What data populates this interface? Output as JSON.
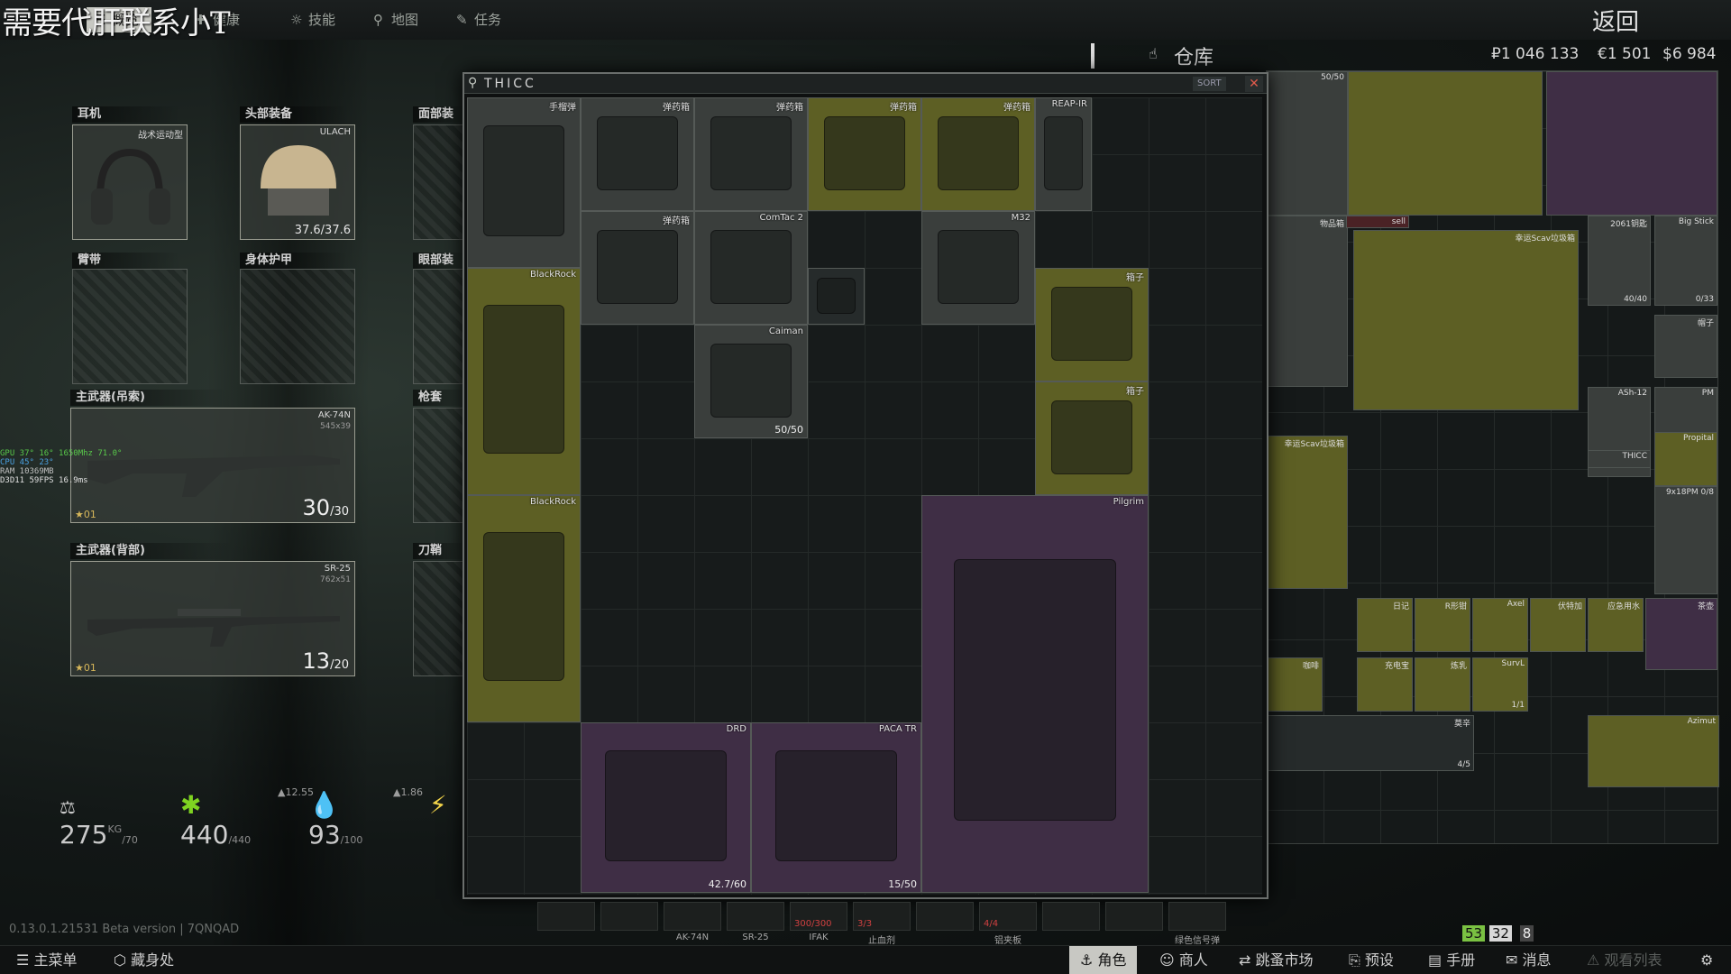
{
  "overlay": {
    "watermark": "需要代肝联系小T"
  },
  "nav": {
    "tabs": [
      {
        "label": "概览",
        "icon": "overview-icon"
      },
      {
        "label": "健康",
        "icon": "health-icon"
      },
      {
        "label": "技能",
        "icon": "skills-icon"
      },
      {
        "label": "地图",
        "icon": "map-pin-icon"
      },
      {
        "label": "任务",
        "icon": "tasks-icon"
      }
    ],
    "back": "返回"
  },
  "stash": {
    "title": "仓库",
    "roubles": "₽1 046 133",
    "euros": "€1 501",
    "dollars": "$6 984"
  },
  "equipment": {
    "earpiece": {
      "label": "耳机",
      "item": "战术运动型"
    },
    "headwear": {
      "label": "头部装备",
      "item": "ULACH",
      "durability": "37.6/37.6"
    },
    "facecover": {
      "label": "面部装"
    },
    "armband": {
      "label": "臂带"
    },
    "body_armor": {
      "label": "身体护甲"
    },
    "eyewear": {
      "label": "眼部装"
    },
    "primary1": {
      "label": "主武器(吊索)",
      "item": "AK-74N",
      "caliber": "545x39",
      "ammo": "30",
      "ammo_max": "/30",
      "rank": "01"
    },
    "holster": {
      "label": "枪套"
    },
    "primary2": {
      "label": "主武器(背部)",
      "item": "SR-25",
      "caliber": "762x51",
      "ammo": "13",
      "ammo_max": "/20",
      "rank": "01"
    },
    "scabbard": {
      "label": "刀鞘"
    }
  },
  "char_stats": {
    "weight": "275",
    "weight_unit": "KG",
    "weight_max": "/70",
    "health": "440",
    "health_max": "/440",
    "health_regen": "▲12.55",
    "hydration": "93",
    "hydration_max": "/100",
    "hydration_regen": "▲1.86"
  },
  "perf": {
    "lines": [
      "GPU   37°  16°  1650Mhz  71.0°",
      "CPU   45°  23°",
      "RAM  10369MB",
      "D3D11   59FPS  16.9ms"
    ]
  },
  "container": {
    "title": "THICC",
    "sort": "SORT",
    "close": "✕",
    "items": [
      {
        "name": "手榴弹",
        "cls": "bg-grey"
      },
      {
        "name": "弹药箱",
        "cls": "bg-grey"
      },
      {
        "name": "弹药箱",
        "cls": "bg-grey"
      },
      {
        "name": "弹药箱",
        "cls": "bg-olive"
      },
      {
        "name": "弹药箱",
        "cls": "bg-olive"
      },
      {
        "name": "REAP-IR",
        "cls": "bg-grey"
      },
      {
        "name": "弹药箱",
        "cls": "bg-grey"
      },
      {
        "name": "ComTac 2",
        "cls": "bg-grey"
      },
      {
        "name": "",
        "cls": "bg-dark"
      },
      {
        "name": "M32",
        "cls": "bg-grey"
      },
      {
        "name": "箱子",
        "cls": "bg-olive"
      },
      {
        "name": "BlackRock",
        "cls": "bg-olive"
      },
      {
        "name": "Caiman",
        "count": "50/50",
        "cls": "bg-grey"
      },
      {
        "name": "箱子",
        "cls": "bg-olive"
      },
      {
        "name": "BlackRock",
        "cls": "bg-olive"
      },
      {
        "name": "Pilgrim",
        "cls": "bg-purple"
      },
      {
        "name": "DRD",
        "count": "42.7/60",
        "cls": "bg-purple"
      },
      {
        "name": "PACA TR",
        "count": "15/50",
        "cls": "bg-purple"
      }
    ]
  },
  "stash_items": [
    {
      "name": "50/50",
      "cls": "bg-grey"
    },
    {
      "name": "",
      "cls": "bg-olive"
    },
    {
      "name": "",
      "cls": "bg-purple"
    },
    {
      "name": "物品箱",
      "cls": "bg-grey"
    },
    {
      "name": "sell",
      "cls": "bg-red"
    },
    {
      "name": "幸运Scav垃圾箱",
      "cls": "bg-olive"
    },
    {
      "name": "2061钥匙",
      "count": "40/40",
      "cls": "bg-grey"
    },
    {
      "name": "Big Stick",
      "count": "0/33",
      "cls": "bg-grey"
    },
    {
      "name": "帽子",
      "cls": "bg-grey"
    },
    {
      "name": "ASh-12",
      "cls": "bg-grey"
    },
    {
      "name": "PM",
      "cls": "bg-grey"
    },
    {
      "name": "THICC",
      "cls": "bg-grey"
    },
    {
      "name": "幸运Scav垃圾箱",
      "cls": "bg-olive"
    },
    {
      "name": "9x18PM 0/8",
      "cls": "bg-grey"
    },
    {
      "name": "Propital",
      "cls": "bg-olive"
    },
    {
      "name": "日记",
      "cls": "bg-olive"
    },
    {
      "name": "R形钳",
      "cls": "bg-olive"
    },
    {
      "name": "Axel",
      "cls": "bg-olive"
    },
    {
      "name": "伏特加",
      "cls": "bg-olive"
    },
    {
      "name": "应急用水",
      "cls": "bg-olive"
    },
    {
      "name": "茶壶",
      "cls": "bg-purple"
    },
    {
      "name": "咖啡",
      "cls": "bg-olive"
    },
    {
      "name": "充电宝",
      "cls": "bg-olive"
    },
    {
      "name": "炼乳",
      "cls": "bg-olive"
    },
    {
      "name": "SurvL",
      "count": "1/1",
      "cls": "bg-olive"
    },
    {
      "name": "莫辛",
      "count": "4/5",
      "cls": "bg-dark"
    },
    {
      "name": "Azimut",
      "cls": "bg-olive"
    }
  ],
  "quickbar": {
    "slots": [
      {
        "label": "",
        "count": ""
      },
      {
        "label": "",
        "count": ""
      },
      {
        "label": "AK-74N",
        "count": ""
      },
      {
        "label": "SR-25",
        "count": ""
      },
      {
        "label": "IFAK",
        "count": "300/300"
      },
      {
        "label": "止血剂",
        "count": "3/3"
      },
      {
        "label": "",
        "count": ""
      },
      {
        "label": "铝夹板",
        "count": "4/4"
      },
      {
        "label": "",
        "count": ""
      },
      {
        "label": "",
        "count": ""
      },
      {
        "label": "绿色信号弹",
        "count": ""
      }
    ]
  },
  "version": "0.13.0.1.21531 Beta version | 7QNQAD",
  "badges": {
    "b1": "53",
    "b2": "32",
    "b3": "8"
  },
  "bottom": {
    "main_menu": "主菜单",
    "hideout": "藏身处",
    "character": "角色",
    "traders": "商人",
    "flea": "跳蚤市场",
    "presets": "预设",
    "handbook": "手册",
    "messages": "消息",
    "watchlist": "观看列表"
  },
  "colors": {
    "olive": "#5d5f24",
    "purple": "#3f2e45",
    "grey": "#3a3e3c",
    "health": "#7ed321",
    "hydration": "#3fa9e0",
    "energy": "#f2d44a"
  }
}
